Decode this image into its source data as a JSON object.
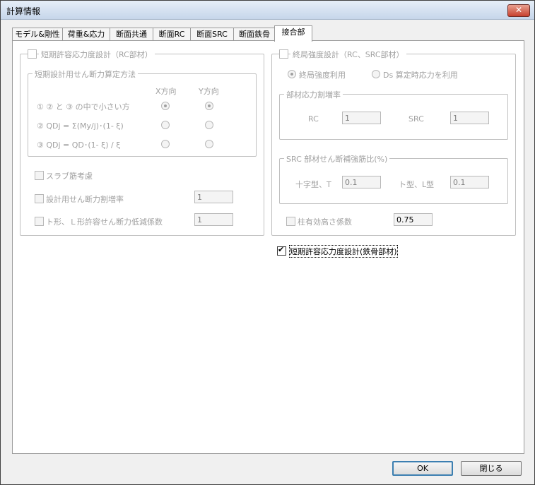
{
  "window": {
    "title": "計算情報",
    "close_glyph": "✕"
  },
  "tabs": [
    {
      "label": "モデル&剛性"
    },
    {
      "label": "荷重&応力"
    },
    {
      "label": "断面共通"
    },
    {
      "label": "断面RC"
    },
    {
      "label": "断面SRC"
    },
    {
      "label": "断面鉄骨"
    },
    {
      "label": "接合部"
    }
  ],
  "left": {
    "group_title": "短期許容応力度設計（RC部材）",
    "sub_title": "短期設計用せん断力算定方法",
    "col_x": "X方向",
    "col_y": "Y方向",
    "rows": [
      {
        "label": "① ② と ③ の中で小さい方",
        "x_selected": true,
        "y_selected": true
      },
      {
        "label": "② QDj = Σ(My/j)･(1- ξ)",
        "x_selected": false,
        "y_selected": false
      },
      {
        "label": "③ QDj = QD･(1- ξ) / ξ",
        "x_selected": false,
        "y_selected": false
      }
    ],
    "slab_label": "スラブ筋考慮",
    "shear_factor_label": "設計用せん断力割増率",
    "shear_factor_value": "1",
    "tl_factor_label": "ト形、Ｌ形許容せん断力低減係数",
    "tl_factor_value": "1"
  },
  "right": {
    "group_title": "終局強度設計（RC、SRC部材）",
    "radio_ultimate": "終局強度利用",
    "radio_ds": "Ds 算定時応力を利用",
    "stress_group_title": "部材応力割増率",
    "rc_label": "RC",
    "rc_value": "1",
    "src_label": "SRC",
    "src_value": "1",
    "src_ratio_title": "SRC 部材せん断補強筋比(%)",
    "cross_label": "十字型、T",
    "cross_value": "0.1",
    "tl_label": "ト型、L型",
    "tl_value": "0.1",
    "column_label": "柱有効高さ係数",
    "column_value": "0.75"
  },
  "steel_label": "短期許容応力度設計(鉄骨部材)",
  "buttons": {
    "ok": "OK",
    "close": "閉じる"
  }
}
